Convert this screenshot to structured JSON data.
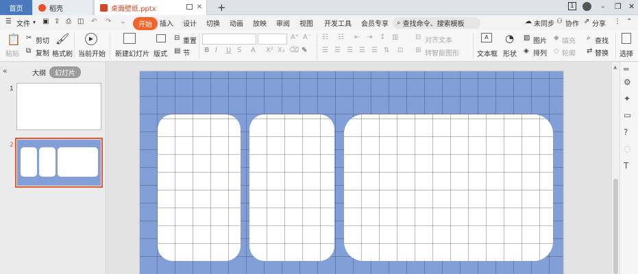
{
  "tabs": {
    "home": "首页",
    "docer": "稻壳",
    "file": "桌面壁纸.pptx",
    "add": "+"
  },
  "window": {
    "badge": "1",
    "min": "–",
    "restore": "❐",
    "close": "✕"
  },
  "menu": {
    "file": "文件",
    "items": [
      "开始",
      "插入",
      "设计",
      "切换",
      "动画",
      "放映",
      "审阅",
      "视图",
      "开发工具",
      "会员专享"
    ],
    "search": "查找命令、搜索模板",
    "unsynced": "未同步",
    "collab": "协作",
    "share": "分享"
  },
  "toolbar": {
    "paste": "粘贴",
    "cut": "剪切",
    "copy": "复制",
    "format_painter": "格式刷",
    "play_from_current": "当前开始",
    "new_slide": "新建幻灯片",
    "layout": "版式",
    "section": "节",
    "reset": "重置",
    "align_text": "对齐文本",
    "smartart": "转智能图形",
    "textbox": "文本框",
    "shape": "形状",
    "arrange": "排列",
    "picture": "图片",
    "fill": "填充",
    "outline": "轮廓",
    "find": "查找",
    "replace": "替换",
    "select": "选择"
  },
  "panel": {
    "outline_tab": "大纲",
    "slides_tab": "幻灯片",
    "slide_numbers": [
      "1",
      "2"
    ]
  },
  "colors": {
    "accent": "#f3632a",
    "home_tab": "#4a79bd",
    "slide_bg": "#839fd8",
    "selected_border": "#e2572f"
  }
}
